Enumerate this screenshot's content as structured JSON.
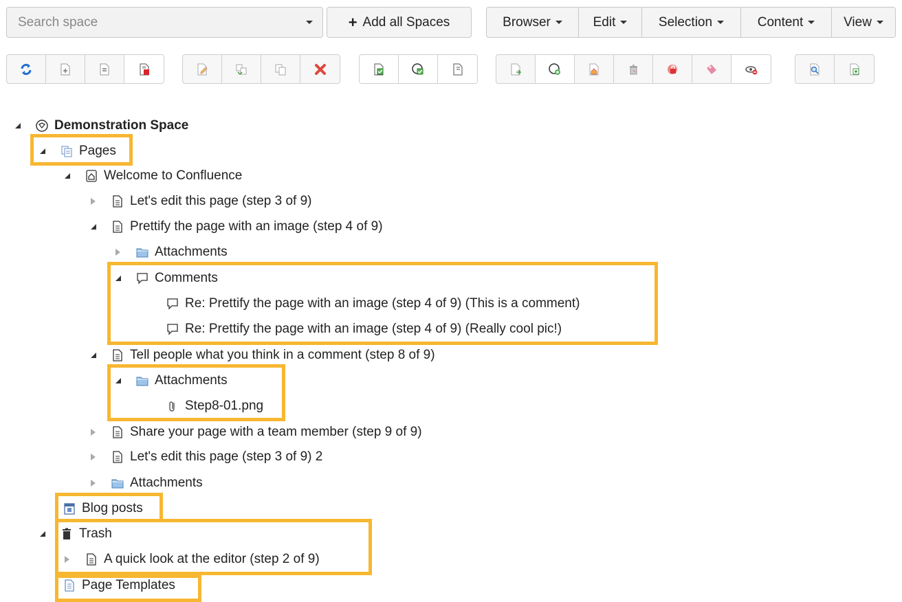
{
  "header": {
    "search_placeholder": "Search space",
    "add_all_label": "Add all Spaces",
    "menus": [
      "Browser",
      "Edit",
      "Selection",
      "Content",
      "View"
    ]
  },
  "toolbar": {
    "groups": [
      [
        "refresh-icon",
        "add-page-icon",
        "remove-page-icon",
        "delete-page-icon"
      ],
      [
        "edit-page-icon",
        "move-page-icon",
        "copy-page-icon",
        "delete-x-icon"
      ],
      [
        "check-page-icon",
        "check-space-icon",
        "page-properties-icon"
      ],
      [
        "page-import-icon",
        "space-import-icon",
        "home-page-icon",
        "trash-restore-icon",
        "lock-page-icon",
        "tag-icon",
        "hide-icon"
      ],
      [
        "preview-icon",
        "report-icon"
      ]
    ]
  },
  "tree": {
    "space": "Demonstration Space",
    "pages": "Pages",
    "welcome": "Welcome to Confluence",
    "lets_edit": "Let's edit this page (step 3 of 9)",
    "prettify": "Prettify the page with an image (step 4 of 9)",
    "attachments_1": "Attachments",
    "comments": "Comments",
    "comment_1": "Re: Prettify the page with an image (step 4 of 9) (This is a comment)",
    "comment_2": "Re: Prettify the page with an image (step 4 of 9) (Really cool pic!)",
    "tell_people": "Tell people what you think in a comment (step 8 of 9)",
    "attachments_2": "Attachments",
    "step8_file": "Step8-01.png",
    "share": "Share your page with a team member (step 9 of 9)",
    "lets_edit_2": "Let's edit this page (step 3 of 9) 2",
    "attachments_3": "Attachments",
    "blog_posts": "Blog posts",
    "trash": "Trash",
    "quick_look": "A quick look at the editor (step 2 of 9)",
    "page_templates": "Page Templates"
  },
  "colors": {
    "highlight": "#f7b731"
  }
}
